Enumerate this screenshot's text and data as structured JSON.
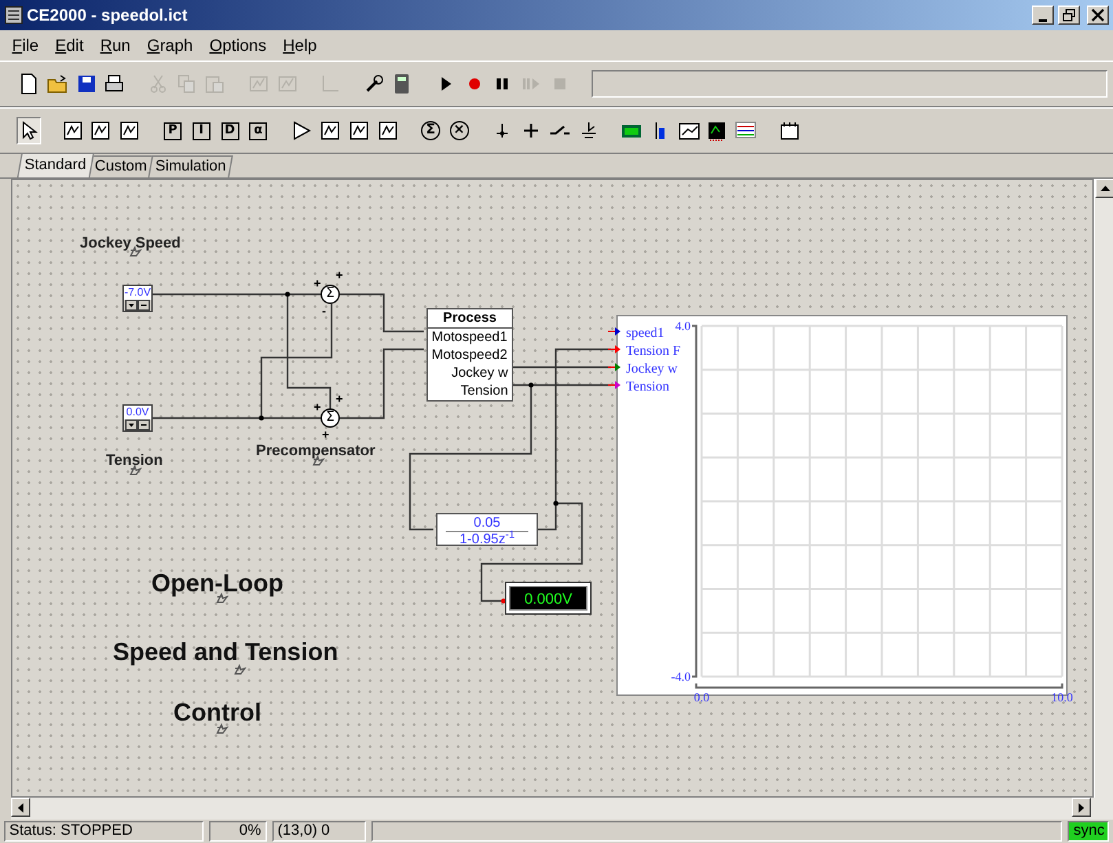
{
  "window": {
    "title": "CE2000 - speedol.ict"
  },
  "menu": [
    "File",
    "Edit",
    "Run",
    "Graph",
    "Options",
    "Help"
  ],
  "toolbar": [
    [
      {
        "kind": "new",
        "disabled": false
      },
      {
        "kind": "open",
        "disabled": false
      },
      {
        "kind": "save",
        "disabled": false
      },
      {
        "kind": "print",
        "disabled": false
      }
    ],
    [
      {
        "kind": "cut",
        "disabled": true
      },
      {
        "kind": "copy",
        "disabled": true
      },
      {
        "kind": "paste",
        "disabled": true
      }
    ],
    [
      {
        "kind": "block",
        "disabled": true
      },
      {
        "kind": "block",
        "disabled": true
      }
    ],
    [
      {
        "kind": "axes",
        "disabled": true
      }
    ],
    [
      {
        "kind": "wrench",
        "disabled": false
      },
      {
        "kind": "calculator",
        "disabled": false
      }
    ],
    [
      {
        "kind": "play",
        "disabled": false
      },
      {
        "kind": "record",
        "disabled": false
      },
      {
        "kind": "pause",
        "disabled": false
      },
      {
        "kind": "step",
        "disabled": true
      },
      {
        "kind": "stop",
        "disabled": true
      }
    ]
  ],
  "palette": [
    [
      {
        "kind": "pointer",
        "selected": true
      }
    ],
    [
      {
        "kind": "block",
        "selected": false
      },
      {
        "kind": "block",
        "selected": false
      },
      {
        "kind": "block",
        "selected": false
      }
    ],
    [
      {
        "kind": "glyph",
        "label": "P",
        "selected": false
      },
      {
        "kind": "glyph",
        "label": "I",
        "selected": false
      },
      {
        "kind": "glyph",
        "label": "D",
        "selected": false
      },
      {
        "kind": "glyph",
        "label": "α",
        "selected": false
      }
    ],
    [
      {
        "kind": "amplifier",
        "selected": false
      },
      {
        "kind": "block",
        "selected": false
      },
      {
        "kind": "block",
        "selected": false
      },
      {
        "kind": "block",
        "selected": false
      }
    ],
    [
      {
        "kind": "circle",
        "label": "Σ",
        "selected": false
      },
      {
        "kind": "circle",
        "label": "×",
        "selected": false
      }
    ],
    [
      {
        "kind": "junction",
        "selected": false
      },
      {
        "kind": "plus",
        "selected": false
      },
      {
        "kind": "switch",
        "selected": false
      },
      {
        "kind": "ground",
        "selected": false
      }
    ],
    [
      {
        "kind": "meter",
        "selected": false
      },
      {
        "kind": "bar",
        "selected": false
      },
      {
        "kind": "scope",
        "selected": false
      },
      {
        "kind": "display",
        "selected": false
      },
      {
        "kind": "plot",
        "selected": false
      }
    ],
    [
      {
        "kind": "note",
        "selected": false
      }
    ]
  ],
  "tabs": [
    {
      "label": "Standard",
      "selected": true
    },
    {
      "label": "Custom",
      "selected": false
    },
    {
      "label": "Simulation",
      "selected": false
    }
  ],
  "canvas": {
    "labels": [
      {
        "text": "Jockey Speed",
        "kind": "caption"
      },
      {
        "text": "Tension",
        "kind": "caption"
      },
      {
        "text": "Precompensator",
        "kind": "caption"
      },
      {
        "text": "Open-Loop",
        "kind": "heading"
      },
      {
        "text": "Speed and Tension",
        "kind": "heading"
      },
      {
        "text": "Control",
        "kind": "heading"
      }
    ],
    "sources": [
      {
        "value": "-7.0V"
      },
      {
        "value": "0.0V"
      }
    ],
    "summers": [
      {
        "symbol": "Σ",
        "signs": [
          "+",
          "+",
          "-"
        ]
      },
      {
        "symbol": "Σ",
        "signs": [
          "+",
          "+",
          "+"
        ]
      }
    ],
    "process": {
      "title": "Process",
      "inputs": [
        "Motospeed1",
        "Motospeed2"
      ],
      "outputs": [
        "Jockey w",
        "Tension"
      ]
    },
    "filter": {
      "numerator": "0.05",
      "denominator": "1-0.95z$^{-1}$"
    },
    "meter": {
      "reading": "0.000V"
    },
    "scope": {
      "inputs": [
        {
          "label": "speed1",
          "color": "#0000cc"
        },
        {
          "label": "Tension F",
          "color": "#ff0000"
        },
        {
          "label": "Jockey w",
          "color": "#008000"
        },
        {
          "label": "Tension",
          "color": "#cc00cc"
        }
      ],
      "chart_data": {
        "type": "line",
        "xlim": [
          0,
          10
        ],
        "ylim": [
          -4,
          4
        ],
        "xticks": [
          {
            "value": 0,
            "label": "0.0"
          },
          {
            "value": 10,
            "label": "10.0"
          }
        ],
        "yticks": [
          {
            "value": -4,
            "label": "-4.0"
          },
          {
            "value": 4,
            "label": "4.0"
          }
        ]
      }
    }
  },
  "status_bar": {
    "status": "Status: STOPPED",
    "progress": "0%",
    "position": "(13,0) 0",
    "sync": "sync"
  }
}
